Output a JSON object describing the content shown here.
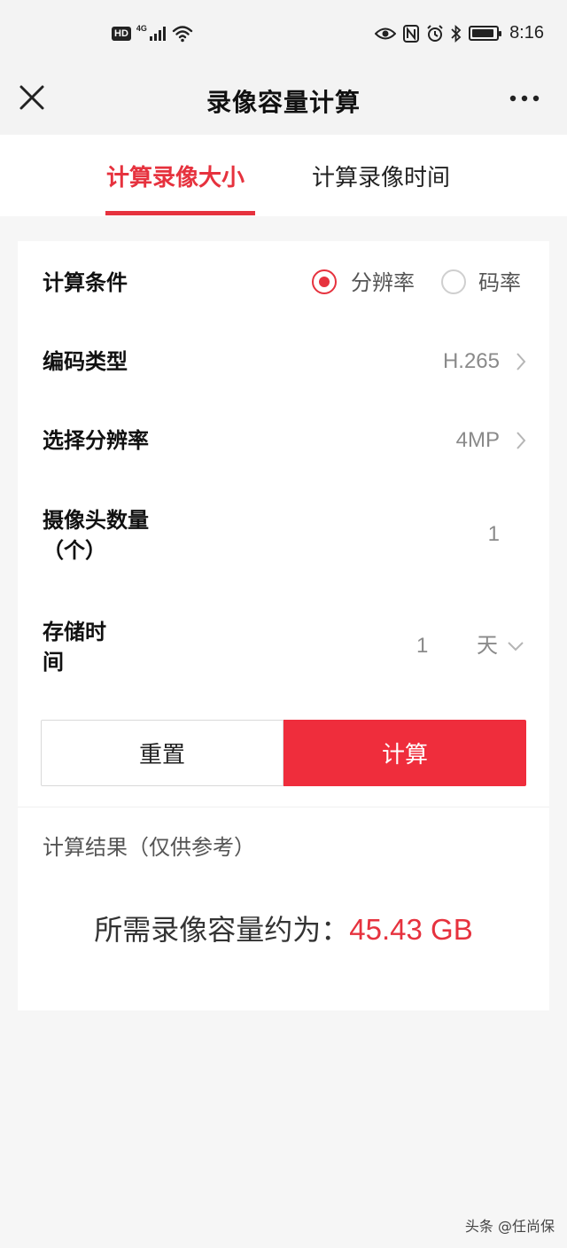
{
  "status_bar": {
    "hd": "HD",
    "network": "4G",
    "time": "8:16",
    "icons": [
      "signal-icon",
      "wifi-icon",
      "eye-icon",
      "nfc-icon",
      "alarm-icon",
      "bluetooth-icon",
      "battery-icon"
    ]
  },
  "header": {
    "title": "录像容量计算",
    "icons": [
      "close-icon",
      "more-icon"
    ]
  },
  "tabs": [
    {
      "label": "计算录像大小",
      "active": true
    },
    {
      "label": "计算录像时间",
      "active": false
    }
  ],
  "form": {
    "condition": {
      "label": "计算条件",
      "options": [
        {
          "label": "分辨率",
          "checked": true
        },
        {
          "label": "码率",
          "checked": false
        }
      ]
    },
    "codec": {
      "label": "编码类型",
      "value": "H.265"
    },
    "resolution": {
      "label": "选择分辨率",
      "value": "4MP"
    },
    "cameras": {
      "label_line1": "摄像头数量",
      "label_line2": "（个）",
      "value": "1"
    },
    "storage": {
      "label_line1": "存储时",
      "label_line2": "间",
      "value": "1",
      "unit": "天"
    }
  },
  "buttons": {
    "reset": "重置",
    "calculate": "计算"
  },
  "result": {
    "title": "计算结果（仅供参考）",
    "label": "所需录像容量约为：",
    "value": "45.43 GB"
  },
  "watermark": "头条 @任尚保",
  "colors": {
    "accent": "#e6323e",
    "button": "#ef2d3c",
    "background": "#f6f6f6"
  }
}
